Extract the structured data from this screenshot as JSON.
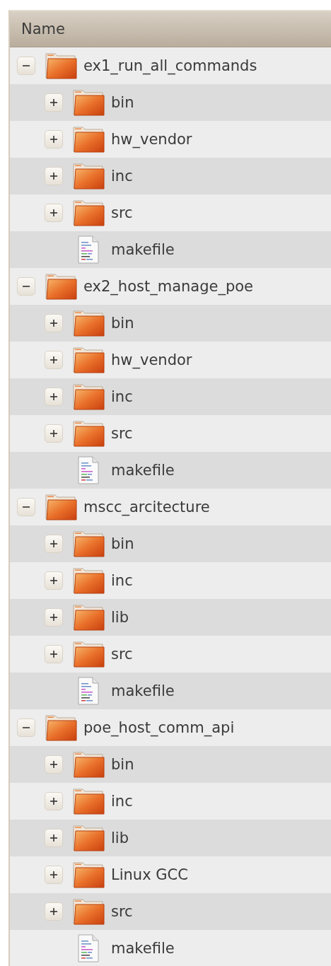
{
  "header": {
    "label": "Name"
  },
  "tree": [
    {
      "kind": "folder",
      "name": "ex1_run_all_commands",
      "expanded": true,
      "children": [
        {
          "kind": "folder",
          "name": "bin",
          "expanded": false
        },
        {
          "kind": "folder",
          "name": "hw_vendor",
          "expanded": false
        },
        {
          "kind": "folder",
          "name": "inc",
          "expanded": false
        },
        {
          "kind": "folder",
          "name": "src",
          "expanded": false
        },
        {
          "kind": "file",
          "name": "makefile"
        }
      ]
    },
    {
      "kind": "folder",
      "name": "ex2_host_manage_poe",
      "expanded": true,
      "children": [
        {
          "kind": "folder",
          "name": "bin",
          "expanded": false
        },
        {
          "kind": "folder",
          "name": "hw_vendor",
          "expanded": false
        },
        {
          "kind": "folder",
          "name": "inc",
          "expanded": false
        },
        {
          "kind": "folder",
          "name": "src",
          "expanded": false
        },
        {
          "kind": "file",
          "name": "makefile"
        }
      ]
    },
    {
      "kind": "folder",
      "name": "mscc_arcitecture",
      "expanded": true,
      "children": [
        {
          "kind": "folder",
          "name": "bin",
          "expanded": false
        },
        {
          "kind": "folder",
          "name": "inc",
          "expanded": false
        },
        {
          "kind": "folder",
          "name": "lib",
          "expanded": false
        },
        {
          "kind": "folder",
          "name": "src",
          "expanded": false
        },
        {
          "kind": "file",
          "name": "makefile"
        }
      ]
    },
    {
      "kind": "folder",
      "name": "poe_host_comm_api",
      "expanded": true,
      "children": [
        {
          "kind": "folder",
          "name": "bin",
          "expanded": false
        },
        {
          "kind": "folder",
          "name": "inc",
          "expanded": false
        },
        {
          "kind": "folder",
          "name": "lib",
          "expanded": false
        },
        {
          "kind": "folder",
          "name": "Linux GCC",
          "expanded": false
        },
        {
          "kind": "folder",
          "name": "src",
          "expanded": false
        },
        {
          "kind": "file",
          "name": "makefile"
        }
      ]
    }
  ]
}
